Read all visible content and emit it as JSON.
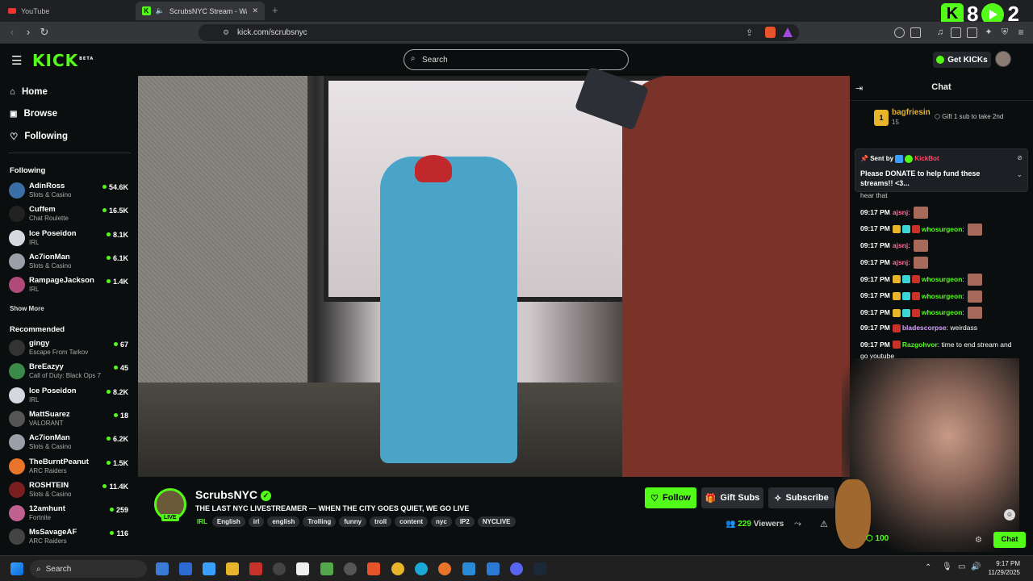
{
  "browser": {
    "tabs": [
      {
        "label": "YouTube",
        "active": false
      },
      {
        "label": "ScrubsNYC Stream - Watch L",
        "active": true
      }
    ],
    "url": "kick.com/scrubsnyc"
  },
  "overlay": {
    "kicks_count": "8",
    "viewers_count": "2"
  },
  "header": {
    "logo": "KICK",
    "logo_badge": "BETA",
    "search_placeholder": "Search",
    "get_kicks_label": "Get KICKs"
  },
  "sidebar": {
    "nav": [
      {
        "label": "Home",
        "icon": "home-icon"
      },
      {
        "label": "Browse",
        "icon": "browse-icon"
      },
      {
        "label": "Following",
        "icon": "heart-icon"
      }
    ],
    "following_header": "Following",
    "following": [
      {
        "name": "AdinRoss",
        "category": "Slots & Casino",
        "viewers": "54.6K",
        "color": "#3a6ea5"
      },
      {
        "name": "Cuffem",
        "category": "Chat Roulette",
        "viewers": "16.5K",
        "color": "#222222"
      },
      {
        "name": "Ice Poseidon",
        "category": "IRL",
        "viewers": "8.1K",
        "color": "#d6d8e0"
      },
      {
        "name": "Ac7ionMan",
        "category": "Slots & Casino",
        "viewers": "6.1K",
        "color": "#9aa0a8"
      },
      {
        "name": "RampageJackson",
        "category": "IRL",
        "viewers": "1.4K",
        "color": "#b04a7a"
      }
    ],
    "show_more": "Show More",
    "recommended_header": "Recommended",
    "recommended": [
      {
        "name": "gingy",
        "category": "Escape From Tarkov",
        "viewers": "67",
        "color": "#333333"
      },
      {
        "name": "BreEazyy",
        "category": "Call of Duty: Black Ops 7",
        "viewers": "45",
        "color": "#3b8a4a"
      },
      {
        "name": "Ice Poseidon",
        "category": "IRL",
        "viewers": "8.2K",
        "color": "#d6d8e0"
      },
      {
        "name": "MattSuarez",
        "category": "VALORANT",
        "viewers": "18",
        "color": "#555555"
      },
      {
        "name": "Ac7ionMan",
        "category": "Slots & Casino",
        "viewers": "6.2K",
        "color": "#9aa0a8"
      },
      {
        "name": "TheBurntPeanut",
        "category": "ARC Raiders",
        "viewers": "1.5K",
        "color": "#e8742a"
      },
      {
        "name": "ROSHTEIN",
        "category": "Slots & Casino",
        "viewers": "11.4K",
        "color": "#7a1f1f"
      },
      {
        "name": "12amhunt",
        "category": "Fortnite",
        "viewers": "259",
        "color": "#c06090"
      },
      {
        "name": "MsSavageAF",
        "category": "ARC Raiders",
        "viewers": "116",
        "color": "#444444"
      }
    ]
  },
  "stream": {
    "live_badge": "LIVE",
    "channel_name": "ScrubsNYC",
    "title": "THE LAST NYC LIVESTREAMER — WHEN THE CITY GOES QUIET, WE GO LIVE",
    "category": "IRL",
    "tags": [
      "English",
      "irl",
      "english",
      "Trolling",
      "funny",
      "troll",
      "content",
      "nyc",
      "IP2",
      "NYCLIVE"
    ],
    "viewers": "229",
    "viewers_label": "Viewers",
    "follow_label": "Follow",
    "gift_subs_label": "Gift Subs",
    "subscribe_label": "Subscribe"
  },
  "chat": {
    "title": "Chat",
    "top_gifter": {
      "rank": "1",
      "name": "bagfriesin",
      "count": "15",
      "cta": "Gift 1 sub to take 2nd"
    },
    "pinned": {
      "sent_by_label": "Sent by",
      "sender": "KickBot",
      "message": "Please DONATE to help fund these streams!! <3..."
    },
    "partial_line": "hear that",
    "messages": [
      {
        "time": "09:17 PM",
        "user": "ajsnj",
        "text": "",
        "color": "#ff6b9a",
        "emote": true,
        "badges": 0
      },
      {
        "time": "09:17 PM",
        "user": "whosurgeon",
        "text": "",
        "color": "#53fc18",
        "emote": true,
        "badges": 3
      },
      {
        "time": "09:17 PM",
        "user": "ajsnj",
        "text": "",
        "color": "#ff6b9a",
        "emote": true,
        "badges": 0
      },
      {
        "time": "09:17 PM",
        "user": "ajsnj",
        "text": "",
        "color": "#ff6b9a",
        "emote": true,
        "badges": 0
      },
      {
        "time": "09:17 PM",
        "user": "whosurgeon",
        "text": "",
        "color": "#53fc18",
        "emote": true,
        "badges": 3
      },
      {
        "time": "09:17 PM",
        "user": "whosurgeon",
        "text": "",
        "color": "#53fc18",
        "emote": true,
        "badges": 3
      },
      {
        "time": "09:17 PM",
        "user": "whosurgeon",
        "text": "",
        "color": "#53fc18",
        "emote": true,
        "badges": 3
      },
      {
        "time": "09:17 PM",
        "user": "bladescorpse",
        "text": "weirdass",
        "color": "#d8a0ff",
        "emote": false,
        "badges": 1
      },
      {
        "time": "09:17 PM",
        "user": "Razgohvor",
        "text": "time to end stream and",
        "color": "#53fc18",
        "emote": false,
        "badges": 1
      }
    ],
    "continuation": "go youtube",
    "points": "100",
    "chat_button": "Chat"
  },
  "taskbar": {
    "search_placeholder": "Search",
    "time": "9:17 PM",
    "date": "11/29/2025"
  }
}
